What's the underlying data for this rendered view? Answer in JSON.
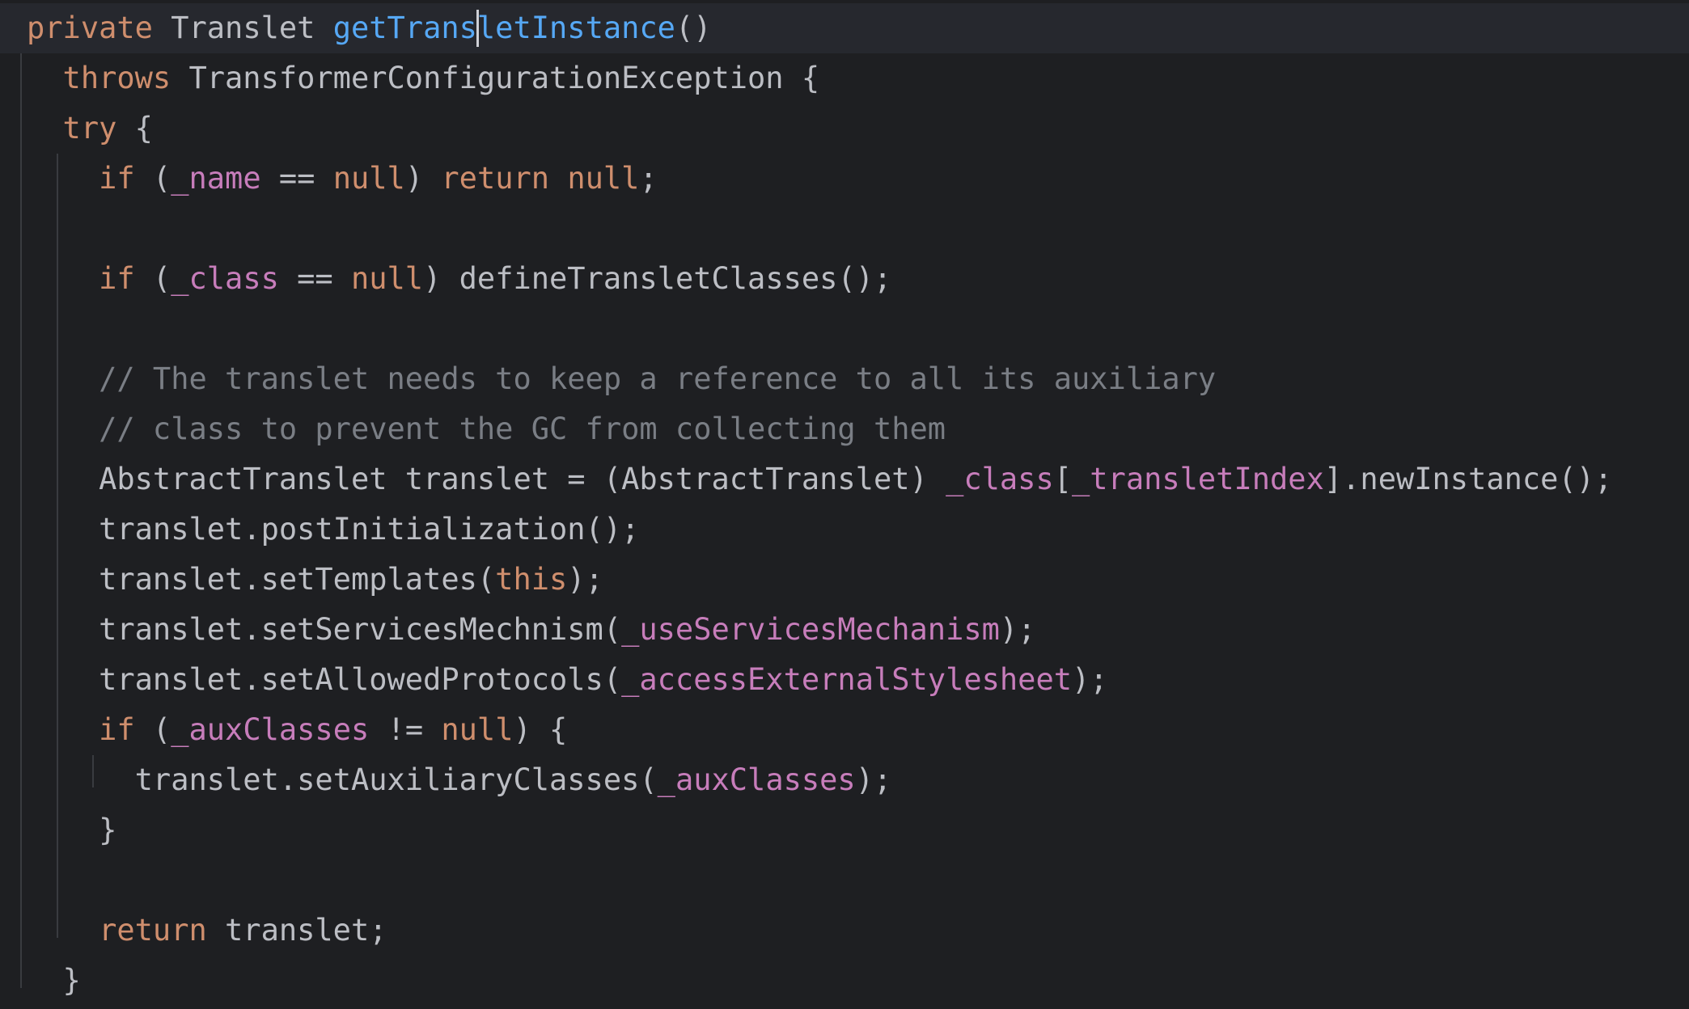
{
  "editor": {
    "language": "Java",
    "caret": {
      "line": 1,
      "column": 26
    },
    "colors": {
      "background": "#1e1f22",
      "current_line": "#26282e",
      "default_text": "#bcbec4",
      "keyword": "#cf8e6d",
      "method_declaration": "#56a8f5",
      "field": "#c77dbb",
      "comment": "#7a7e85",
      "indent_guide": "#393b40"
    },
    "lines": [
      {
        "indent": 0,
        "current": true,
        "tokens": [
          {
            "t": "private",
            "k": "kw"
          },
          {
            "t": " Translet ",
            "k": "tx"
          },
          {
            "t": "getTransletInstance",
            "k": "fn"
          },
          {
            "t": "()",
            "k": "tx"
          }
        ]
      },
      {
        "indent": 2,
        "tokens": [
          {
            "t": "throws",
            "k": "kw"
          },
          {
            "t": " TransformerConfigurationException {",
            "k": "tx"
          }
        ]
      },
      {
        "indent": 2,
        "tokens": [
          {
            "t": "try",
            "k": "kw"
          },
          {
            "t": " {",
            "k": "tx"
          }
        ]
      },
      {
        "indent": 4,
        "tokens": [
          {
            "t": "if",
            "k": "kw"
          },
          {
            "t": " (",
            "k": "tx"
          },
          {
            "t": "_name",
            "k": "fld"
          },
          {
            "t": " == ",
            "k": "tx"
          },
          {
            "t": "null",
            "k": "kw"
          },
          {
            "t": ") ",
            "k": "tx"
          },
          {
            "t": "return",
            "k": "kw"
          },
          {
            "t": " ",
            "k": "tx"
          },
          {
            "t": "null",
            "k": "kw"
          },
          {
            "t": ";",
            "k": "tx"
          }
        ]
      },
      {
        "indent": 0,
        "tokens": []
      },
      {
        "indent": 4,
        "tokens": [
          {
            "t": "if",
            "k": "kw"
          },
          {
            "t": " (",
            "k": "tx"
          },
          {
            "t": "_class",
            "k": "fld"
          },
          {
            "t": " == ",
            "k": "tx"
          },
          {
            "t": "null",
            "k": "kw"
          },
          {
            "t": ") defineTransletClasses();",
            "k": "tx"
          }
        ]
      },
      {
        "indent": 0,
        "tokens": []
      },
      {
        "indent": 4,
        "tokens": [
          {
            "t": "// The translet needs to keep a reference to all its auxiliary",
            "k": "cm"
          }
        ]
      },
      {
        "indent": 4,
        "tokens": [
          {
            "t": "// class to prevent the GC from collecting them",
            "k": "cm"
          }
        ]
      },
      {
        "indent": 4,
        "tokens": [
          {
            "t": "AbstractTranslet translet = (AbstractTranslet) ",
            "k": "tx"
          },
          {
            "t": "_class",
            "k": "fld"
          },
          {
            "t": "[",
            "k": "tx"
          },
          {
            "t": "_transletIndex",
            "k": "fld"
          },
          {
            "t": "].newInstance();",
            "k": "tx"
          }
        ]
      },
      {
        "indent": 4,
        "tokens": [
          {
            "t": "translet.postInitialization();",
            "k": "tx"
          }
        ]
      },
      {
        "indent": 4,
        "tokens": [
          {
            "t": "translet.setTemplates(",
            "k": "tx"
          },
          {
            "t": "this",
            "k": "kw"
          },
          {
            "t": ");",
            "k": "tx"
          }
        ]
      },
      {
        "indent": 4,
        "tokens": [
          {
            "t": "translet.setServicesMechnism(",
            "k": "tx"
          },
          {
            "t": "_useServicesMechanism",
            "k": "fld"
          },
          {
            "t": ");",
            "k": "tx"
          }
        ]
      },
      {
        "indent": 4,
        "tokens": [
          {
            "t": "translet.setAllowedProtocols(",
            "k": "tx"
          },
          {
            "t": "_accessExternalStylesheet",
            "k": "fld"
          },
          {
            "t": ");",
            "k": "tx"
          }
        ]
      },
      {
        "indent": 4,
        "tokens": [
          {
            "t": "if",
            "k": "kw"
          },
          {
            "t": " (",
            "k": "tx"
          },
          {
            "t": "_auxClasses",
            "k": "fld"
          },
          {
            "t": " != ",
            "k": "tx"
          },
          {
            "t": "null",
            "k": "kw"
          },
          {
            "t": ") {",
            "k": "tx"
          }
        ]
      },
      {
        "indent": 6,
        "tokens": [
          {
            "t": "translet.setAuxiliaryClasses(",
            "k": "tx"
          },
          {
            "t": "_auxClasses",
            "k": "fld"
          },
          {
            "t": ");",
            "k": "tx"
          }
        ]
      },
      {
        "indent": 4,
        "tokens": [
          {
            "t": "}",
            "k": "tx"
          }
        ]
      },
      {
        "indent": 0,
        "tokens": []
      },
      {
        "indent": 4,
        "tokens": [
          {
            "t": "return",
            "k": "kw"
          },
          {
            "t": " translet;",
            "k": "tx"
          }
        ]
      },
      {
        "indent": 2,
        "tokens": [
          {
            "t": "}",
            "k": "tx"
          }
        ]
      }
    ]
  }
}
